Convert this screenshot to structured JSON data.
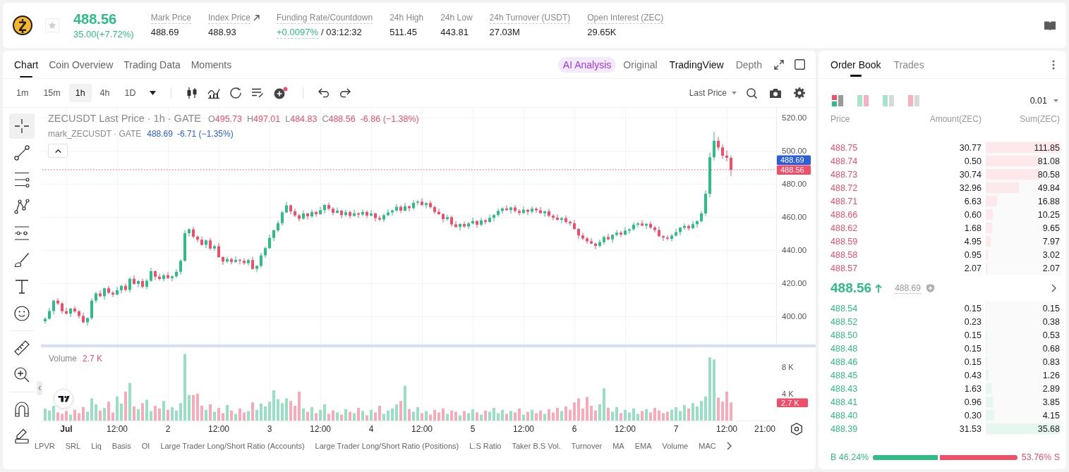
{
  "header": {
    "price": "488.56",
    "change": "35.00(+7.72%)",
    "starred": false,
    "stats": [
      {
        "kind": "plain",
        "label": "Mark Price",
        "value": "488.69",
        "hint": true
      },
      {
        "kind": "link",
        "label": "Index Price",
        "value": "488.93",
        "hint": true
      },
      {
        "kind": "funding",
        "label": "Funding Rate/Countdown",
        "value": "+0.0097%",
        "countdown": "/ 03:12:32",
        "hint": true
      },
      {
        "kind": "plain",
        "label": "24h High",
        "value": "511.45",
        "hint": false
      },
      {
        "kind": "plain",
        "label": "24h Low",
        "value": "443.81",
        "hint": false
      },
      {
        "kind": "plain",
        "label": "24h Turnover (USDT)",
        "value": "27.03M",
        "hint": true
      },
      {
        "kind": "plain",
        "label": "Open Interest (ZEC)",
        "value": "29.65K",
        "hint": true
      }
    ]
  },
  "chart_panel": {
    "tabs": [
      {
        "label": "Chart",
        "selected": true
      },
      {
        "label": "Coin Overview",
        "selected": false
      },
      {
        "label": "Trading Data",
        "selected": false
      },
      {
        "label": "Moments",
        "selected": false
      }
    ],
    "views": [
      {
        "kind": "ai",
        "label": "AI Analysis",
        "selected": false
      },
      {
        "kind": "plain",
        "label": "Original",
        "selected": false
      },
      {
        "kind": "plain",
        "label": "TradingView",
        "selected": true
      },
      {
        "kind": "plain",
        "label": "Depth",
        "selected": false
      }
    ],
    "toolbar": {
      "intervals": [
        {
          "label": "1m",
          "selected": false
        },
        {
          "label": "15m",
          "selected": false
        },
        {
          "label": "1h",
          "selected": true
        },
        {
          "label": "4h",
          "selected": false
        },
        {
          "label": "1D",
          "selected": false
        }
      ],
      "alert_badge": true,
      "price_source": "Last Price"
    },
    "drawing_tools": [
      {
        "tools": [
          {
            "kind": "crosshair",
            "selected": true
          },
          {
            "kind": "trend-line",
            "selected": false
          },
          {
            "kind": "fib-lines",
            "selected": false
          },
          {
            "kind": "pattern",
            "selected": false
          },
          {
            "kind": "projection",
            "selected": false
          },
          {
            "kind": "brush",
            "selected": false
          },
          {
            "kind": "text",
            "selected": false
          },
          {
            "kind": "emoji",
            "selected": false
          }
        ]
      },
      {
        "tools": [
          {
            "kind": "ruler",
            "selected": false
          },
          {
            "kind": "zoom",
            "selected": false
          }
        ]
      },
      {
        "tools": [
          {
            "kind": "magnet",
            "selected": false
          },
          {
            "kind": "lock-draw",
            "selected": false
          }
        ]
      }
    ],
    "legend": {
      "title": "ZECUSDT Last Price · 1h · GATE",
      "ohlc": [
        {
          "key": "O",
          "value": "495.73"
        },
        {
          "key": "H",
          "value": "497.01"
        },
        {
          "key": "L",
          "value": "484.83"
        },
        {
          "key": "C",
          "value": "488.56"
        }
      ],
      "change": "-6.86 (−1.38%)",
      "expanded": true
    },
    "mark_legend": {
      "title": "mark_ZECUSDT · GATE",
      "value": "488.69",
      "change": "-6.71 (−1.35%)"
    },
    "chart_data": {
      "type": "candlestick",
      "grid": true,
      "xlim": [
        0.75,
        7.9861
      ],
      "ylim": [
        383,
        526
      ],
      "yticks": [
        {
          "value": 520,
          "label": "520.00"
        },
        {
          "value": 500,
          "label": "500.00"
        },
        {
          "value": 480,
          "label": "480.00"
        },
        {
          "value": 460,
          "label": "460.00"
        },
        {
          "value": 440,
          "label": "440.00"
        },
        {
          "value": 420,
          "label": "420.00"
        },
        {
          "value": 400,
          "label": "400.00"
        }
      ],
      "x": [
        0.7917,
        0.8333,
        0.875,
        0.9167,
        0.9583,
        1,
        1.0417,
        1.0833,
        1.125,
        1.1667,
        1.2083,
        1.25,
        1.2917,
        1.3333,
        1.375,
        1.4167,
        1.4583,
        1.5,
        1.5417,
        1.5833,
        1.625,
        1.6667,
        1.7083,
        1.75,
        1.7917,
        1.8333,
        1.875,
        1.9167,
        1.9583,
        2,
        2.0417,
        2.0833,
        2.125,
        2.1667,
        2.2083,
        2.25,
        2.2917,
        2.3333,
        2.375,
        2.4167,
        2.4583,
        2.5,
        2.5417,
        2.5833,
        2.625,
        2.6667,
        2.7083,
        2.75,
        2.7917,
        2.8333,
        2.875,
        2.9167,
        2.9583,
        3,
        3.0417,
        3.0833,
        3.125,
        3.1667,
        3.2083,
        3.25,
        3.2917,
        3.3333,
        3.375,
        3.4167,
        3.4583,
        3.5,
        3.5417,
        3.5833,
        3.625,
        3.6667,
        3.7083,
        3.75,
        3.7917,
        3.8333,
        3.875,
        3.9167,
        3.9583,
        4,
        4.0417,
        4.0833,
        4.125,
        4.1667,
        4.2083,
        4.25,
        4.2917,
        4.3333,
        4.375,
        4.4167,
        4.4583,
        4.5,
        4.5417,
        4.5833,
        4.625,
        4.6667,
        4.7083,
        4.75,
        4.7917,
        4.8333,
        4.875,
        4.9167,
        4.9583,
        5,
        5.0417,
        5.0833,
        5.125,
        5.1667,
        5.2083,
        5.25,
        5.2917,
        5.3333,
        5.375,
        5.4167,
        5.4583,
        5.5,
        5.5417,
        5.5833,
        5.625,
        5.6667,
        5.7083,
        5.75,
        5.7917,
        5.8333,
        5.875,
        5.9167,
        5.9583,
        6,
        6.0417,
        6.0833,
        6.125,
        6.1667,
        6.2083,
        6.25,
        6.2917,
        6.3333,
        6.375,
        6.4167,
        6.4583,
        6.5,
        6.5417,
        6.5833,
        6.625,
        6.6667,
        6.7083,
        6.75,
        6.7917,
        6.8333,
        6.875,
        6.9167,
        6.9583,
        7,
        7.0417,
        7.0833,
        7.125,
        7.1667,
        7.2083,
        7.25,
        7.2917,
        7.3333,
        7.375,
        7.4167,
        7.4583,
        7.5,
        7.5417
      ],
      "ohlc": [
        [
          397.0,
          399.5,
          395.5,
          398.5
        ],
        [
          398.5,
          405.2,
          398.0,
          403.2
        ],
        [
          403.2,
          410.0,
          401.2,
          409.5
        ],
        [
          409.5,
          411.0,
          406.8,
          407.8
        ],
        [
          407.8,
          408.8,
          401.6,
          403.1
        ],
        [
          403.1,
          405.1,
          401.1,
          401.6
        ],
        [
          401.6,
          405.2,
          399.6,
          404.7
        ],
        [
          404.7,
          406.2,
          402.0,
          403.0
        ],
        [
          403.0,
          404.0,
          398.7,
          400.2
        ],
        [
          400.2,
          402.2,
          395.9,
          396.4
        ],
        [
          396.4,
          399.4,
          394.4,
          398.9
        ],
        [
          398.9,
          411.0,
          397.9,
          409.5
        ],
        [
          409.5,
          414.8,
          408.0,
          413.8
        ],
        [
          413.8,
          415.8,
          411.6,
          412.1
        ],
        [
          412.1,
          417.4,
          410.1,
          416.9
        ],
        [
          416.9,
          418.4,
          413.3,
          414.3
        ],
        [
          414.3,
          415.3,
          411.7,
          413.2
        ],
        [
          413.2,
          417.8,
          412.7,
          415.8
        ],
        [
          415.8,
          418.9,
          413.8,
          418.4
        ],
        [
          418.4,
          419.9,
          415.0,
          416.0
        ],
        [
          416.0,
          423.7,
          414.5,
          422.7
        ],
        [
          422.7,
          424.7,
          419.1,
          419.6
        ],
        [
          419.6,
          421.8,
          417.6,
          421.3
        ],
        [
          421.3,
          422.8,
          416.9,
          417.9
        ],
        [
          417.9,
          422.5,
          416.4,
          421.5
        ],
        [
          421.5,
          429.3,
          421.0,
          427.3
        ],
        [
          427.3,
          427.8,
          422.0,
          424.0
        ],
        [
          424.0,
          425.5,
          421.6,
          422.6
        ],
        [
          422.6,
          425.8,
          421.1,
          424.8
        ],
        [
          424.8,
          426.8,
          422.6,
          423.1
        ],
        [
          423.1,
          424.7,
          421.1,
          424.2
        ],
        [
          424.2,
          428.4,
          423.2,
          426.9
        ],
        [
          426.9,
          434.5,
          425.4,
          433.5
        ],
        [
          433.5,
          452.2,
          433.0,
          450.2
        ],
        [
          450.2,
          453.1,
          448.2,
          452.6
        ],
        [
          452.6,
          454.1,
          447.1,
          448.1
        ],
        [
          448.1,
          449.1,
          444.8,
          446.3
        ],
        [
          446.3,
          448.3,
          442.7,
          443.2
        ],
        [
          443.2,
          446.4,
          441.2,
          445.9
        ],
        [
          445.9,
          447.4,
          440.0,
          441.0
        ],
        [
          441.0,
          443.4,
          439.5,
          442.4
        ],
        [
          442.4,
          444.4,
          435.3,
          435.8
        ],
        [
          435.8,
          436.3,
          431.1,
          433.1
        ],
        [
          433.1,
          436.1,
          432.1,
          434.6
        ],
        [
          434.6,
          435.6,
          431.4,
          432.9
        ],
        [
          432.9,
          436.2,
          432.4,
          434.2
        ],
        [
          434.2,
          434.7,
          431.5,
          433.5
        ],
        [
          433.5,
          435.0,
          431.2,
          432.2
        ],
        [
          432.2,
          435.0,
          430.7,
          434.0
        ],
        [
          434.0,
          436.0,
          428.2,
          428.7
        ],
        [
          428.7,
          431.0,
          426.7,
          430.5
        ],
        [
          430.5,
          438.3,
          429.5,
          436.8
        ],
        [
          436.8,
          442.2,
          435.3,
          441.2
        ],
        [
          441.2,
          449.4,
          440.7,
          447.4
        ],
        [
          447.4,
          452.4,
          445.4,
          451.9
        ],
        [
          451.9,
          457.8,
          450.9,
          456.3
        ],
        [
          456.3,
          463.8,
          454.8,
          462.8
        ],
        [
          462.8,
          469.1,
          462.3,
          467.1
        ],
        [
          467.1,
          467.6,
          461.5,
          463.5
        ],
        [
          463.5,
          465.0,
          460.0,
          461.0
        ],
        [
          461.0,
          462.0,
          457.4,
          458.9
        ],
        [
          458.9,
          464.1,
          458.4,
          462.1
        ],
        [
          462.1,
          462.6,
          458.4,
          460.4
        ],
        [
          460.4,
          464.5,
          459.4,
          463.0
        ],
        [
          463.0,
          464.0,
          460.2,
          461.7
        ],
        [
          461.7,
          466.2,
          461.2,
          464.2
        ],
        [
          464.2,
          467.8,
          462.2,
          467.3
        ],
        [
          467.3,
          468.8,
          464.0,
          465.0
        ],
        [
          465.0,
          466.0,
          461.1,
          462.6
        ],
        [
          462.6,
          465.8,
          462.1,
          463.8
        ],
        [
          463.8,
          464.3,
          459.2,
          461.2
        ],
        [
          461.2,
          464.4,
          460.2,
          462.9
        ],
        [
          462.9,
          463.9,
          459.2,
          460.7
        ],
        [
          460.7,
          464.3,
          460.2,
          462.3
        ],
        [
          462.3,
          462.8,
          459.5,
          461.5
        ],
        [
          461.5,
          464.5,
          460.5,
          463.0
        ],
        [
          463.0,
          464.0,
          459.4,
          460.9
        ],
        [
          460.9,
          464.2,
          460.4,
          462.2
        ],
        [
          462.2,
          462.7,
          457.4,
          459.4
        ],
        [
          459.4,
          460.9,
          457.6,
          458.6
        ],
        [
          458.6,
          462.1,
          457.1,
          461.1
        ],
        [
          461.1,
          464.8,
          460.6,
          462.8
        ],
        [
          462.8,
          464.5,
          460.8,
          464.0
        ],
        [
          464.0,
          467.7,
          463.0,
          466.2
        ],
        [
          466.2,
          467.2,
          462.4,
          463.9
        ],
        [
          463.9,
          468.5,
          463.4,
          466.5
        ],
        [
          466.5,
          467.0,
          463.4,
          465.4
        ],
        [
          465.4,
          470.1,
          464.4,
          468.6
        ],
        [
          468.6,
          470.3,
          467.1,
          469.3
        ],
        [
          469.3,
          471.3,
          466.7,
          467.2
        ],
        [
          467.2,
          468.9,
          465.2,
          468.4
        ],
        [
          468.4,
          469.9,
          465.0,
          466.0
        ],
        [
          466.0,
          467.0,
          461.6,
          463.1
        ],
        [
          463.1,
          465.1,
          461.3,
          461.8
        ],
        [
          461.8,
          462.3,
          456.7,
          458.7
        ],
        [
          458.7,
          461.4,
          457.7,
          459.9
        ],
        [
          459.9,
          460.9,
          454.1,
          455.6
        ],
        [
          455.6,
          457.6,
          453.5,
          454.0
        ],
        [
          454.0,
          456.3,
          452.0,
          455.8
        ],
        [
          455.8,
          457.3,
          453.3,
          454.3
        ],
        [
          454.3,
          457.1,
          452.8,
          456.1
        ],
        [
          456.1,
          459.6,
          455.6,
          457.6
        ],
        [
          457.6,
          458.1,
          453.4,
          455.4
        ],
        [
          455.4,
          459.5,
          454.4,
          458.0
        ],
        [
          458.0,
          459.0,
          455.6,
          457.1
        ],
        [
          457.1,
          461.5,
          456.6,
          459.5
        ],
        [
          459.5,
          461.7,
          457.5,
          461.2
        ],
        [
          461.2,
          465.1,
          460.2,
          463.6
        ],
        [
          463.6,
          466.1,
          462.1,
          465.1
        ],
        [
          465.1,
          467.1,
          463.7,
          464.2
        ],
        [
          464.2,
          466.3,
          462.2,
          465.8
        ],
        [
          465.8,
          467.3,
          462.7,
          463.7
        ],
        [
          463.7,
          464.7,
          461.0,
          462.5
        ],
        [
          462.5,
          466.4,
          462.0,
          464.4
        ],
        [
          464.4,
          464.9,
          461.2,
          463.2
        ],
        [
          463.2,
          466.5,
          462.2,
          465.0
        ],
        [
          465.0,
          466.0,
          462.6,
          464.1
        ],
        [
          464.1,
          466.1,
          461.8,
          462.3
        ],
        [
          462.3,
          464.0,
          460.3,
          463.5
        ],
        [
          463.5,
          465.0,
          459.8,
          460.8
        ],
        [
          460.8,
          461.8,
          458.1,
          459.6
        ],
        [
          459.6,
          461.6,
          457.8,
          458.3
        ],
        [
          458.3,
          459.9,
          456.3,
          459.4
        ],
        [
          459.4,
          460.9,
          456.0,
          457.0
        ],
        [
          457.0,
          458.0,
          454.7,
          456.2
        ],
        [
          456.2,
          458.2,
          452.3,
          452.8
        ],
        [
          452.8,
          453.3,
          446.9,
          448.9
        ],
        [
          448.9,
          450.4,
          446.1,
          447.1
        ],
        [
          447.1,
          448.1,
          443.8,
          445.3
        ],
        [
          445.3,
          447.3,
          443.5,
          444.0
        ],
        [
          444.0,
          444.5,
          440.6,
          442.6
        ],
        [
          442.6,
          446.3,
          441.6,
          444.8
        ],
        [
          444.8,
          448.9,
          443.3,
          447.9
        ],
        [
          447.9,
          449.9,
          446.0,
          446.5
        ],
        [
          446.5,
          449.7,
          444.5,
          449.2
        ],
        [
          449.2,
          452.1,
          448.2,
          450.6
        ],
        [
          450.6,
          451.6,
          447.9,
          449.4
        ],
        [
          449.4,
          453.8,
          448.9,
          451.8
        ],
        [
          451.8,
          453.1,
          449.8,
          452.6
        ],
        [
          452.6,
          456.8,
          451.6,
          455.3
        ],
        [
          455.3,
          457.1,
          453.8,
          456.1
        ],
        [
          456.1,
          458.1,
          454.3,
          454.8
        ],
        [
          454.8,
          456.4,
          452.8,
          455.9
        ],
        [
          455.9,
          457.4,
          452.7,
          453.7
        ],
        [
          453.7,
          454.7,
          450.7,
          452.2
        ],
        [
          452.2,
          454.2,
          447.9,
          448.4
        ],
        [
          448.4,
          448.9,
          445.6,
          447.6
        ],
        [
          447.6,
          449.1,
          445.9,
          446.9
        ],
        [
          446.9,
          449.8,
          445.4,
          448.8
        ],
        [
          448.8,
          452.9,
          448.3,
          450.9
        ],
        [
          450.9,
          454.0,
          448.9,
          453.5
        ],
        [
          453.5,
          456.1,
          452.5,
          454.6
        ],
        [
          454.6,
          455.6,
          451.7,
          453.2
        ],
        [
          453.2,
          457.7,
          452.7,
          455.7
        ],
        [
          455.7,
          458.0,
          453.7,
          457.5
        ],
        [
          457.5,
          463.6,
          456.5,
          462.1
        ],
        [
          462.1,
          476.1,
          460.6,
          474.1
        ],
        [
          474.1,
          499.0,
          472.0,
          496.1
        ],
        [
          496.1,
          511.45,
          494.2,
          506.1
        ],
        [
          506.1,
          508.3,
          500.2,
          502.1
        ],
        [
          502.1,
          504.0,
          495.2,
          497.1
        ],
        [
          497.1,
          500.2,
          493.8,
          495.73
        ],
        [
          495.73,
          497.01,
          484.83,
          488.56
        ]
      ],
      "ref_lines": [
        {
          "axis": "y",
          "value": 488.56,
          "color": "#ef4f69"
        }
      ]
    },
    "price_badges": [
      {
        "value": "488.69",
        "color": "#2b5fd9"
      },
      {
        "value": "488.56",
        "color": "#ef4f69"
      }
    ],
    "volume": {
      "label": "Volume",
      "value": "2.7 K",
      "badge": "2.7 K",
      "chart_data": {
        "type": "bar",
        "stacked": true,
        "grid": true,
        "xlim": [
          0.75,
          7.9861
        ],
        "ylim": [
          0,
          10.9
        ],
        "yticks": [
          {
            "value": 8,
            "label": "8 K"
          },
          {
            "value": 4,
            "label": "4 K"
          }
        ],
        "xticks": [
          {
            "value": 1,
            "label": "Jul"
          },
          2,
          3,
          4,
          5,
          6,
          7
        ],
        "x": [
          0.7917,
          0.8333,
          0.875,
          0.9167,
          0.9583,
          1,
          1.0417,
          1.0833,
          1.125,
          1.1667,
          1.2083,
          1.25,
          1.2917,
          1.3333,
          1.375,
          1.4167,
          1.4583,
          1.5,
          1.5417,
          1.5833,
          1.625,
          1.6667,
          1.7083,
          1.75,
          1.7917,
          1.8333,
          1.875,
          1.9167,
          1.9583,
          2,
          2.0417,
          2.0833,
          2.125,
          2.1667,
          2.2083,
          2.25,
          2.2917,
          2.3333,
          2.375,
          2.4167,
          2.4583,
          2.5,
          2.5417,
          2.5833,
          2.625,
          2.6667,
          2.7083,
          2.75,
          2.7917,
          2.8333,
          2.875,
          2.9167,
          2.9583,
          3,
          3.0417,
          3.0833,
          3.125,
          3.1667,
          3.2083,
          3.25,
          3.2917,
          3.3333,
          3.375,
          3.4167,
          3.4583,
          3.5,
          3.5417,
          3.5833,
          3.625,
          3.6667,
          3.7083,
          3.75,
          3.7917,
          3.8333,
          3.875,
          3.9167,
          3.9583,
          4,
          4.0417,
          4.0833,
          4.125,
          4.1667,
          4.2083,
          4.25,
          4.2917,
          4.3333,
          4.375,
          4.4167,
          4.4583,
          4.5,
          4.5417,
          4.5833,
          4.625,
          4.6667,
          4.7083,
          4.75,
          4.7917,
          4.8333,
          4.875,
          4.9167,
          4.9583,
          5,
          5.0417,
          5.0833,
          5.125,
          5.1667,
          5.2083,
          5.25,
          5.2917,
          5.3333,
          5.375,
          5.4167,
          5.4583,
          5.5,
          5.5417,
          5.5833,
          5.625,
          5.6667,
          5.7083,
          5.75,
          5.7917,
          5.8333,
          5.875,
          5.9167,
          5.9583,
          6,
          6.0417,
          6.0833,
          6.125,
          6.1667,
          6.2083,
          6.25,
          6.2917,
          6.3333,
          6.375,
          6.4167,
          6.4583,
          6.5,
          6.5417,
          6.5833,
          6.625,
          6.6667,
          6.7083,
          6.75,
          6.7917,
          6.8333,
          6.875,
          6.9167,
          6.9583,
          7,
          7.0417,
          7.0833,
          7.125,
          7.1667,
          7.2083,
          7.25,
          7.2917,
          7.3333,
          7.375,
          7.4167,
          7.4583,
          7.5,
          7.5417
        ],
        "series": [
          {
            "color": "#98dfc3",
            "values": [
              1.8,
              1.5,
              2.2,
              null,
              null,
              null,
              0.9,
              null,
              null,
              null,
              1.3,
              3.3,
              2.4,
              null,
              1.9,
              null,
              null,
              3.6,
              2.5,
              null,
              5.6,
              null,
              1.7,
              null,
              3.1,
              1.4,
              null,
              null,
              2.9,
              null,
              2.0,
              1.5,
              2.6,
              9.9,
              3.8,
              null,
              null,
              null,
              1.6,
              null,
              1.3,
              null,
              null,
              2.3,
              null,
              1.0,
              null,
              null,
              1.4,
              null,
              1.6,
              2.5,
              2.1,
              2.8,
              4.5,
              3.2,
              2.6,
              3.3,
              null,
              null,
              null,
              1.8,
              null,
              2.0,
              null,
              1.6,
              2.4,
              null,
              null,
              1.2,
              null,
              1.7,
              null,
              1.1,
              null,
              1.4,
              null,
              1.6,
              null,
              null,
              1.0,
              1.5,
              1.8,
              2.4,
              null,
              5.2,
              null,
              1.3,
              2.0,
              null,
              1.4,
              null,
              null,
              null,
              null,
              1.0,
              null,
              null,
              0.8,
              null,
              1.1,
              1.7,
              null,
              0.9,
              null,
              1.3,
              1.9,
              1.1,
              1.6,
              null,
              1.4,
              null,
              null,
              0.9,
              null,
              1.6,
              null,
              null,
              1.0,
              null,
              null,
              null,
              1.4,
              null,
              null,
              null,
              null,
              null,
              null,
              null,
              null,
              2.4,
              4.8,
              null,
              1.3,
              2.0,
              null,
              1.6,
              1.2,
              1.8,
              1.0,
              null,
              1.7,
              null,
              null,
              null,
              null,
              null,
              1.6,
              2.0,
              1.4,
              2.3,
              null,
              2.6,
              2.1,
              2.9,
              3.6,
              9.4,
              9.1,
              null,
              null,
              null,
              null
            ]
          },
          {
            "color": "#f7abb8",
            "values": [
              null,
              null,
              null,
              1.2,
              1.0,
              1.4,
              null,
              1.6,
              1.1,
              2.0,
              null,
              null,
              null,
              1.5,
              null,
              2.8,
              1.2,
              null,
              null,
              4.3,
              null,
              2.1,
              null,
              2.6,
              null,
              null,
              2.2,
              1.8,
              null,
              1.6,
              null,
              null,
              null,
              null,
              null,
              3.8,
              4.0,
              2.2,
              null,
              2.4,
              null,
              1.9,
              1.1,
              null,
              1.5,
              null,
              1.8,
              1.2,
              null,
              2.7,
              null,
              null,
              null,
              null,
              null,
              null,
              null,
              null,
              2.9,
              2.2,
              4.3,
              null,
              1.3,
              null,
              1.1,
              null,
              null,
              1.0,
              1.5,
              null,
              0.9,
              null,
              1.3,
              null,
              1.9,
              null,
              0.8,
              null,
              1.2,
              2.2,
              null,
              null,
              null,
              null,
              2.9,
              null,
              1.7,
              null,
              null,
              1.1,
              null,
              0.9,
              1.6,
              1.2,
              1.8,
              null,
              1.5,
              1.3,
              null,
              1.4,
              null,
              null,
              1.2,
              null,
              1.5,
              null,
              null,
              null,
              null,
              1.0,
              null,
              1.2,
              1.8,
              null,
              1.3,
              null,
              1.1,
              1.5,
              null,
              1.7,
              1.2,
              1.9,
              null,
              2.1,
              1.6,
              2.7,
              3.3,
              1.8,
              3.5,
              2.2,
              1.5,
              null,
              null,
              1.9,
              null,
              null,
              1.1,
              null,
              null,
              null,
              null,
              1.4,
              null,
              1.2,
              1.9,
              1.5,
              1.1,
              1.3,
              null,
              null,
              null,
              null,
              1.8,
              null,
              null,
              null,
              null,
              null,
              null,
              3.4,
              2.8,
              4.3,
              2.7
            ]
          }
        ]
      }
    },
    "time_marks": [
      "12:00",
      "12:00",
      "12:00",
      "12:00",
      "12:00",
      "12:00",
      "12:00",
      "21:00"
    ],
    "indicators": [
      "LPVR",
      "SRL",
      "Liq",
      "Basis",
      "OI",
      "Large Trader Long/Short Ratio (Accounts)",
      "Large Trader Long/Short Ratio (Positions)",
      "L.S Ratio",
      "Taker B.S Vol.",
      "Turnover",
      "MA",
      "EMA",
      "Volume",
      "MAC"
    ]
  },
  "order_book": {
    "tabs": [
      {
        "label": "Order Book",
        "selected": true
      },
      {
        "label": "Trades",
        "selected": false
      }
    ],
    "layouts": [
      {
        "kind": "both",
        "selected": true
      },
      {
        "kind": "split",
        "selected": false
      },
      {
        "kind": "bids",
        "selected": false
      },
      {
        "kind": "asks",
        "selected": false
      }
    ],
    "precision": "0.01",
    "columns": [
      "Price",
      "Amount(ZEC)",
      "Sum(ZEC)"
    ],
    "asks": [
      {
        "price": "488.75",
        "amount": "30.77",
        "sum": "111.85",
        "level": 1
      },
      {
        "price": "488.74",
        "amount": "0.50",
        "sum": "81.08",
        "level": 0.725
      },
      {
        "price": "488.73",
        "amount": "30.74",
        "sum": "80.58",
        "level": 0.72
      },
      {
        "price": "488.72",
        "amount": "32.96",
        "sum": "49.84",
        "level": 0.446
      },
      {
        "price": "488.71",
        "amount": "6.63",
        "sum": "16.88",
        "level": 0.151
      },
      {
        "price": "488.66",
        "amount": "0.60",
        "sum": "10.25",
        "level": 0.092
      },
      {
        "price": "488.62",
        "amount": "1.68",
        "sum": "9.65",
        "level": 0.086
      },
      {
        "price": "488.59",
        "amount": "4.95",
        "sum": "7.97",
        "level": 0.071
      },
      {
        "price": "488.58",
        "amount": "0.95",
        "sum": "3.02",
        "level": 0.027
      },
      {
        "price": "488.57",
        "amount": "2.07",
        "sum": "2.07",
        "level": 0.019
      }
    ],
    "last": {
      "price": "488.56",
      "rising": true,
      "mark": "488.69"
    },
    "bids": [
      {
        "price": "488.54",
        "amount": "0.15",
        "sum": "0.15",
        "level": 0.004
      },
      {
        "price": "488.52",
        "amount": "0.23",
        "sum": "0.38",
        "level": 0.011
      },
      {
        "price": "488.50",
        "amount": "0.15",
        "sum": "0.53",
        "level": 0.015
      },
      {
        "price": "488.48",
        "amount": "0.15",
        "sum": "0.68",
        "level": 0.019
      },
      {
        "price": "488.46",
        "amount": "0.15",
        "sum": "0.83",
        "level": 0.023
      },
      {
        "price": "488.45",
        "amount": "0.43",
        "sum": "1.26",
        "level": 0.035
      },
      {
        "price": "488.43",
        "amount": "1.63",
        "sum": "2.89",
        "level": 0.081
      },
      {
        "price": "488.41",
        "amount": "0.96",
        "sum": "3.85",
        "level": 0.108
      },
      {
        "price": "488.40",
        "amount": "0.30",
        "sum": "4.15",
        "level": 0.116
      },
      {
        "price": "488.39",
        "amount": "31.53",
        "sum": "35.68",
        "level": 1
      }
    ],
    "ratio": {
      "buy": "B 46.24%",
      "sell": "53.76% S",
      "level": 0.4624
    }
  }
}
